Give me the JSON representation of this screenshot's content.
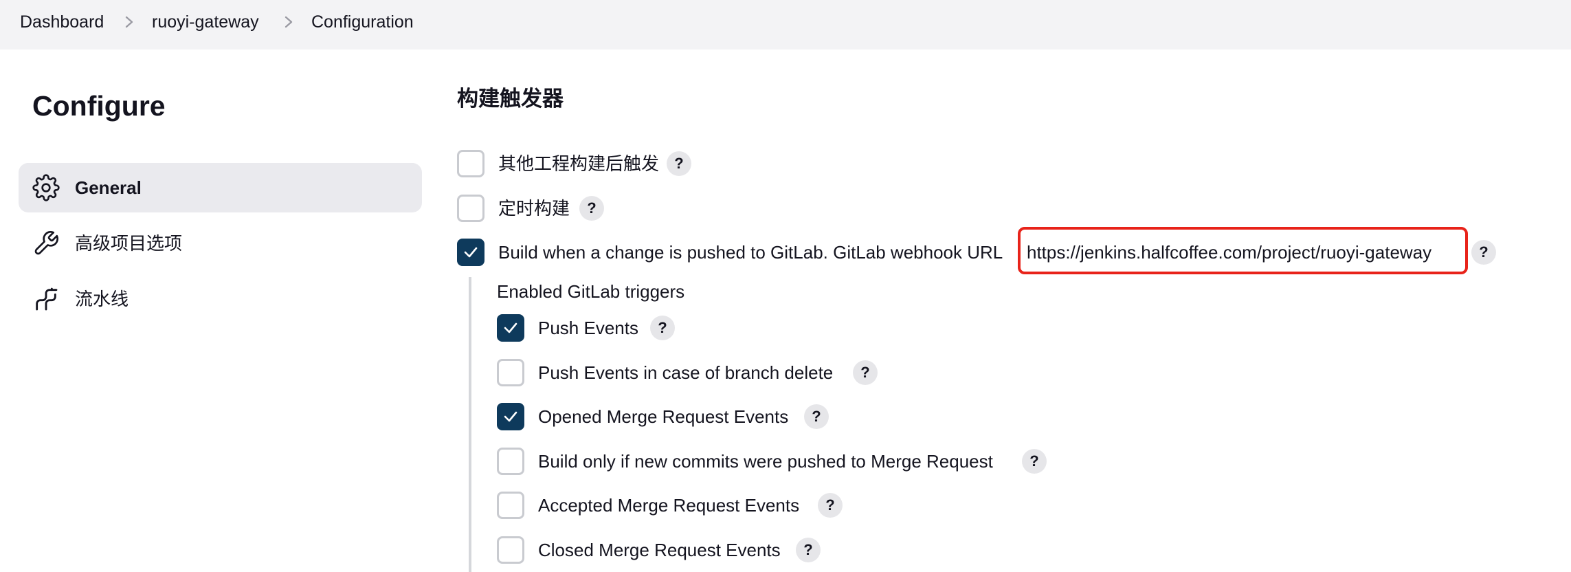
{
  "breadcrumb": {
    "items": [
      "Dashboard",
      "ruoyi-gateway",
      "Configuration"
    ]
  },
  "sidebar": {
    "title": "Configure",
    "items": [
      {
        "label": "General",
        "icon": "gear-icon",
        "active": true
      },
      {
        "label": "高级项目选项",
        "icon": "wrench-icon",
        "active": false
      },
      {
        "label": "流水线",
        "icon": "pipeline-icon",
        "active": false
      }
    ]
  },
  "triggers": {
    "title": "构建触发器",
    "options": [
      {
        "label": "其他工程构建后触发",
        "checked": false
      },
      {
        "label": "定时构建",
        "checked": false
      },
      {
        "label": "Build when a change is pushed to GitLab. GitLab webhook URL",
        "checked": true
      }
    ],
    "webhook_url": "https://jenkins.halfcoffee.com/project/ruoyi-gateway",
    "help_glyph": "?"
  },
  "gitlab_triggers": {
    "title": "Enabled GitLab triggers",
    "items": [
      {
        "label": "Push Events",
        "checked": true
      },
      {
        "label": "Push Events in case of branch delete",
        "checked": false
      },
      {
        "label": "Opened Merge Request Events",
        "checked": true
      },
      {
        "label": "Build only if new commits were pushed to Merge Request",
        "checked": false
      },
      {
        "label": "Accepted Merge Request Events",
        "checked": false
      },
      {
        "label": "Closed Merge Request Events",
        "checked": false
      }
    ]
  },
  "colors": {
    "checkbox_checked": "#0e3a5c",
    "highlight_box": "#e8231a",
    "topbar_bg": "#f3f3f5",
    "nav_active_bg": "#eaeaee"
  }
}
